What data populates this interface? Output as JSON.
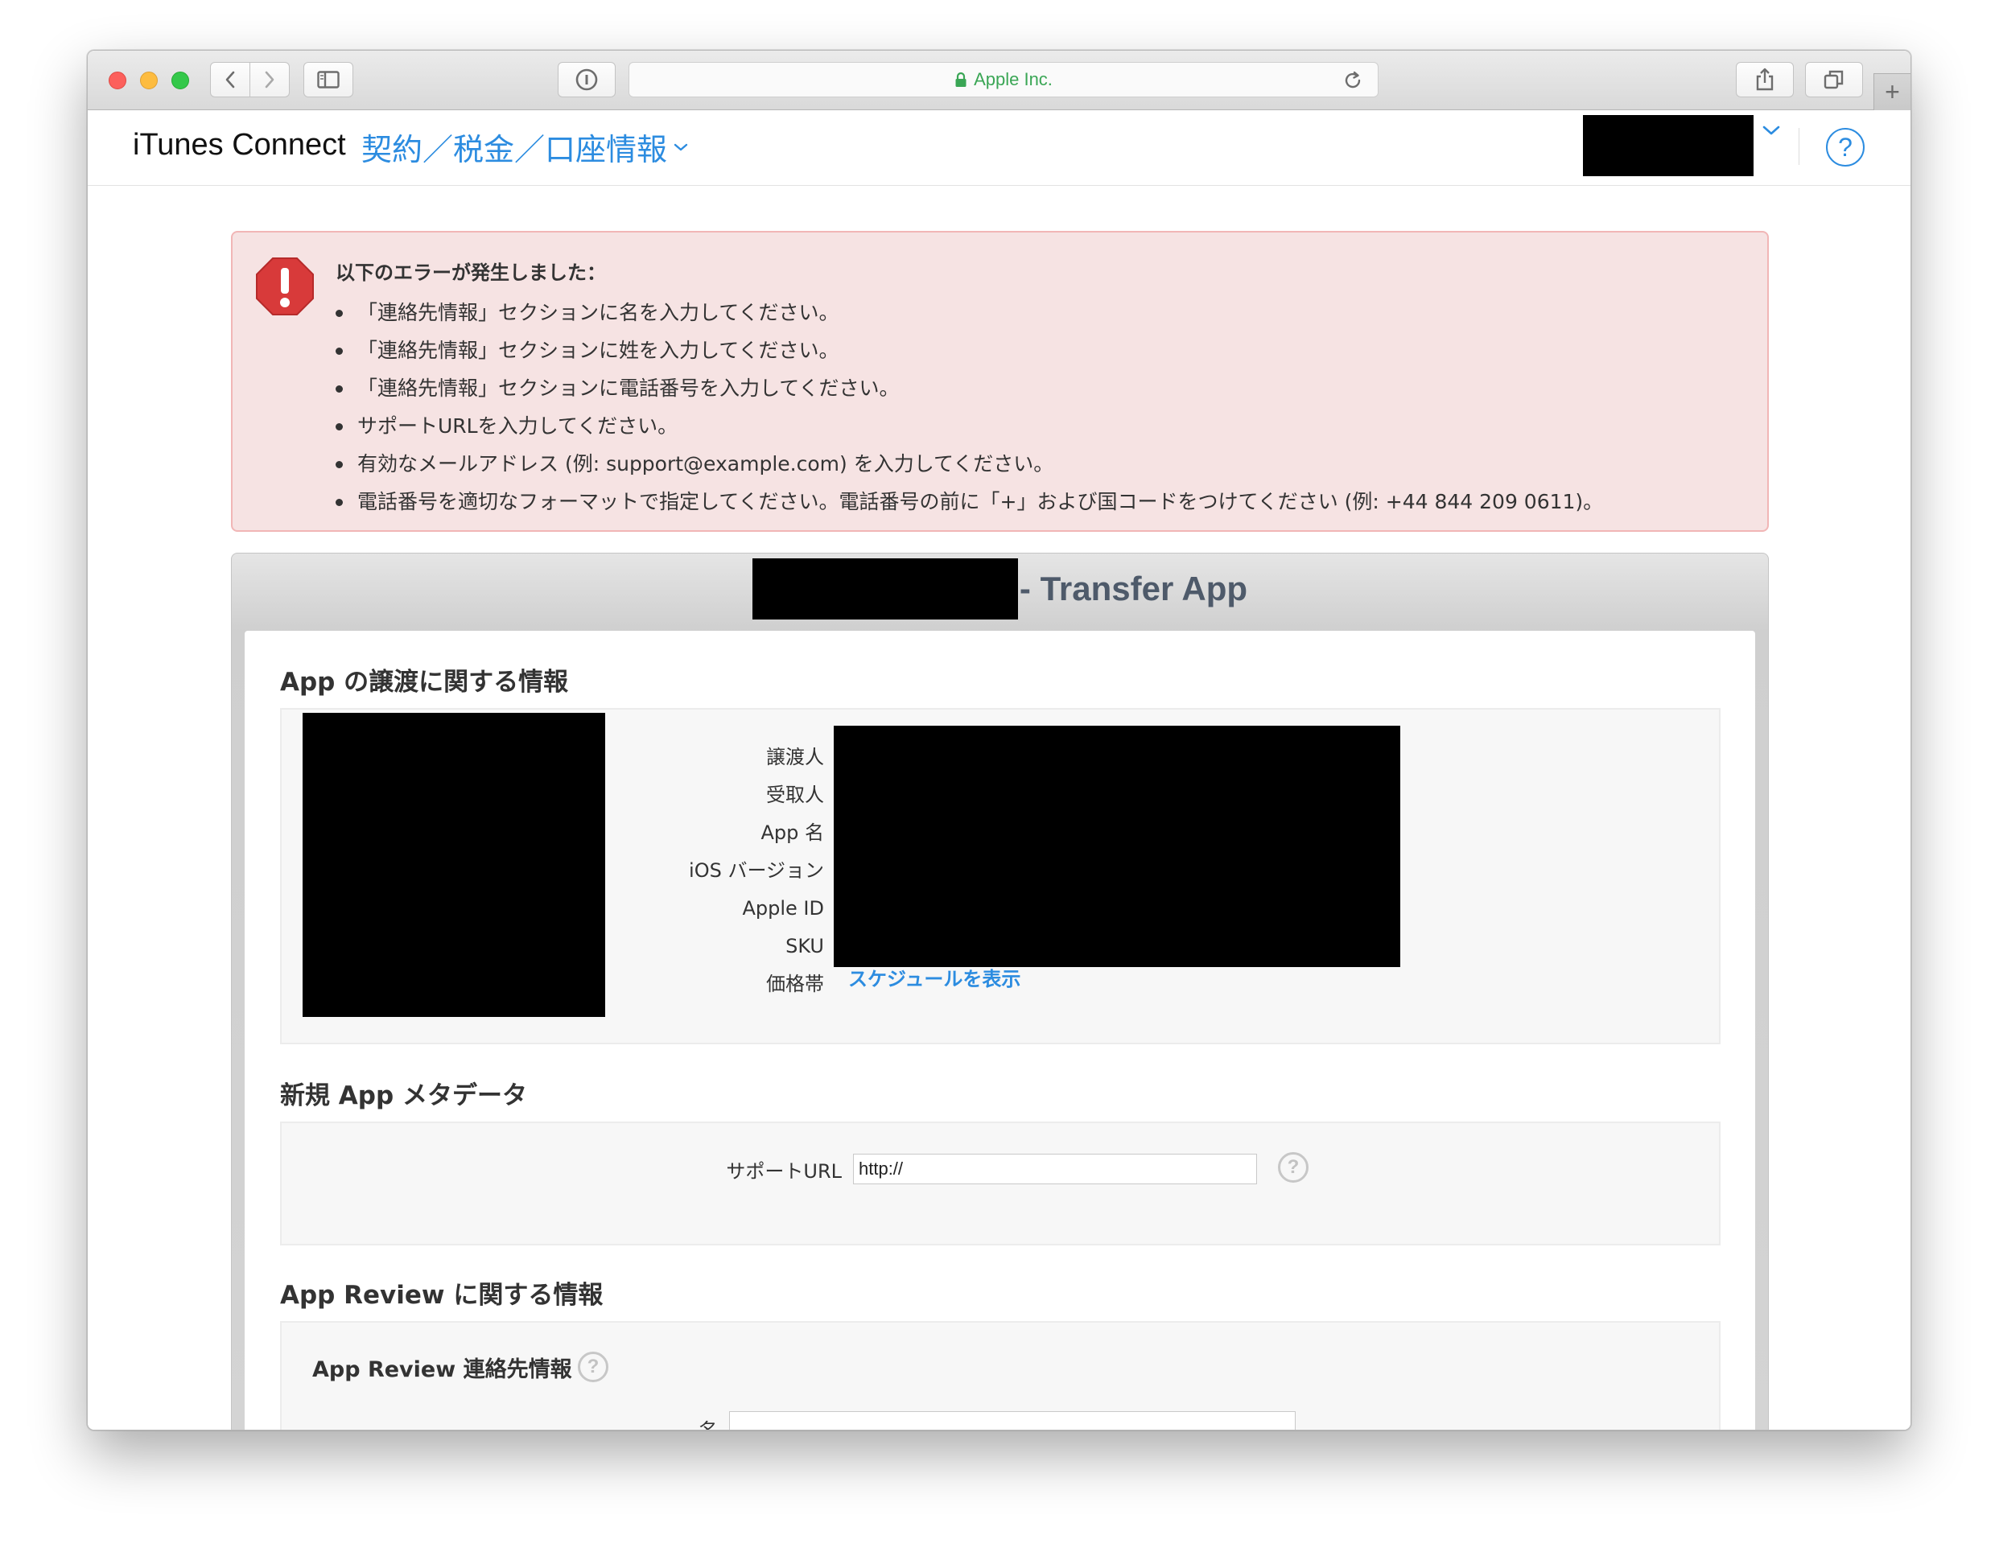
{
  "browser": {
    "url_display": "Apple Inc.",
    "icons": {
      "back": "chevron-left-icon",
      "forward": "chevron-right-icon",
      "sidebar": "sidebar-icon",
      "reader": "info-icon",
      "lock": "lock-icon",
      "reload": "reload-icon",
      "share": "share-icon",
      "tabs": "tabs-overview-icon",
      "new_tab": "plus-icon"
    },
    "new_tab_label": "+"
  },
  "header": {
    "brand": "iTunes Connect",
    "section": "契約／税金／口座情報",
    "help_label": "?",
    "accent_color": "#2c8ce0"
  },
  "error": {
    "title": "以下のエラーが発生しました：",
    "items": [
      "「連絡先情報」セクションに名を入力してください。",
      "「連絡先情報」セクションに姓を入力してください。",
      "「連絡先情報」セクションに電話番号を入力してください。",
      "サポートURLを入力してください。",
      "有効なメールアドレス (例: support@example.com) を入力してください。",
      "電話番号を適切なフォーマットで指定してください。電話番号の前に「+」および国コードをつけてください (例: +44 844 209 0611)。"
    ],
    "background_color": "#f6e3e3",
    "icon_color": "#d83a3a"
  },
  "panel": {
    "title_suffix": "- Transfer App"
  },
  "transfer_info": {
    "heading": "App の譲渡に関する情報",
    "labels": [
      "譲渡人",
      "受取人",
      "App 名",
      "iOS バージョン",
      "Apple ID",
      "SKU",
      "価格帯"
    ],
    "price_link": "スケジュールを表示"
  },
  "metadata": {
    "heading": "新規 App メタデータ",
    "support_url_label": "サポートURL",
    "support_url_value": "http://",
    "help_label": "?"
  },
  "review": {
    "heading": "App Review に関する情報",
    "contact_heading": "App Review 連絡先情報",
    "help_label": "?",
    "first_name_label": "名",
    "first_name_value": ""
  }
}
